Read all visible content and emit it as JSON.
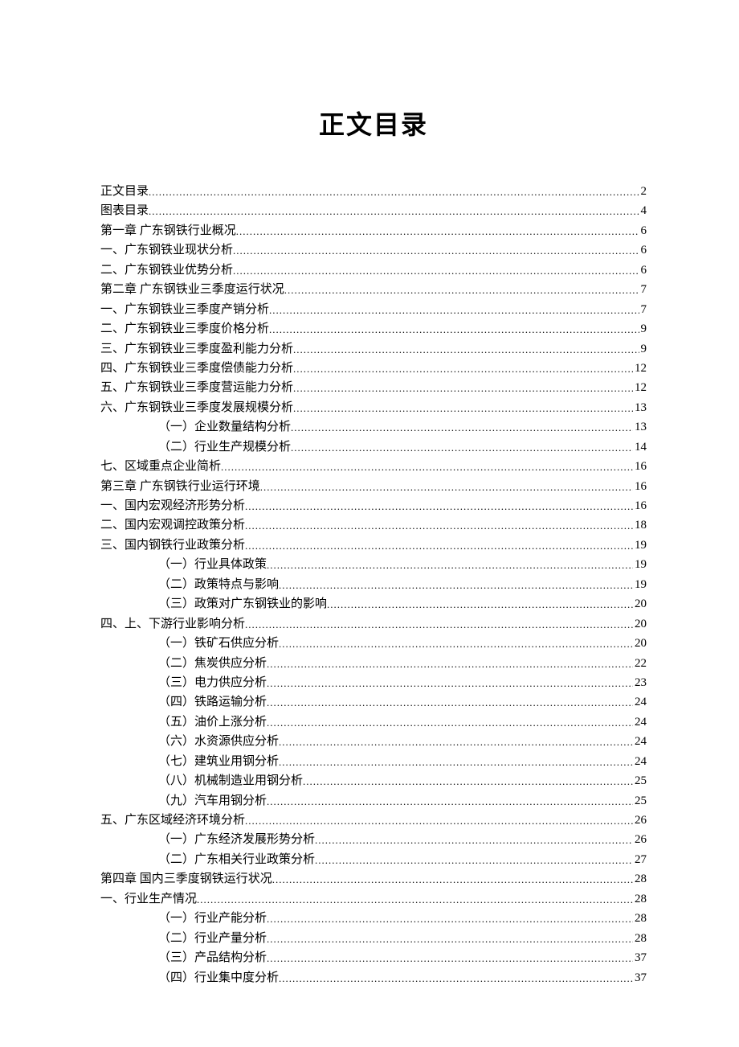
{
  "title": "正文目录",
  "toc": [
    {
      "label": "正文目录",
      "page": "2",
      "level": 0
    },
    {
      "label": "图表目录",
      "page": "4",
      "level": 0
    },
    {
      "label": "第一章 广东钢铁行业概况",
      "page": "6",
      "level": 0
    },
    {
      "label": "一、广东钢铁业现状分析",
      "page": "6",
      "level": 1
    },
    {
      "label": "二、广东钢铁业优势分析",
      "page": "6",
      "level": 1
    },
    {
      "label": "第二章 广东钢铁业三季度运行状况",
      "page": "7",
      "level": 0
    },
    {
      "label": "一、广东钢铁业三季度产销分析",
      "page": "7",
      "level": 1
    },
    {
      "label": "二、广东钢铁业三季度价格分析",
      "page": "9",
      "level": 1
    },
    {
      "label": "三、广东钢铁业三季度盈利能力分析",
      "page": "9",
      "level": 1
    },
    {
      "label": "四、广东钢铁业三季度偿债能力分析",
      "page": "12",
      "level": 1
    },
    {
      "label": "五、广东钢铁业三季度营运能力分析",
      "page": "12",
      "level": 1
    },
    {
      "label": "六、广东钢铁业三季度发展规模分析",
      "page": "13",
      "level": 1
    },
    {
      "label": "（一）企业数量结构分析",
      "page": "13",
      "level": 2
    },
    {
      "label": "（二）行业生产规模分析",
      "page": "14",
      "level": 2
    },
    {
      "label": "七、区域重点企业简析",
      "page": "16",
      "level": 1
    },
    {
      "label": "第三章 广东钢铁行业运行环境",
      "page": "16",
      "level": 0
    },
    {
      "label": "一、国内宏观经济形势分析",
      "page": "16",
      "level": 1
    },
    {
      "label": "二、国内宏观调控政策分析",
      "page": "18",
      "level": 1
    },
    {
      "label": "三、国内钢铁行业政策分析",
      "page": "19",
      "level": 1
    },
    {
      "label": "（一）行业具体政策",
      "page": "19",
      "level": 2
    },
    {
      "label": "（二）政策特点与影响",
      "page": "19",
      "level": 2
    },
    {
      "label": "（三）政策对广东钢铁业的影响",
      "page": "20",
      "level": 2
    },
    {
      "label": "四、上、下游行业影响分析",
      "page": "20",
      "level": 1
    },
    {
      "label": "（一）铁矿石供应分析",
      "page": "20",
      "level": 2
    },
    {
      "label": "（二）焦炭供应分析",
      "page": "22",
      "level": 2
    },
    {
      "label": "（三）电力供应分析",
      "page": "23",
      "level": 2
    },
    {
      "label": "（四）铁路运输分析",
      "page": "24",
      "level": 2
    },
    {
      "label": "（五）油价上涨分析",
      "page": "24",
      "level": 2
    },
    {
      "label": "（六）水资源供应分析",
      "page": "24",
      "level": 2
    },
    {
      "label": "（七）建筑业用钢分析",
      "page": "24",
      "level": 2
    },
    {
      "label": "（八）机械制造业用钢分析",
      "page": "25",
      "level": 2
    },
    {
      "label": "（九）汽车用钢分析",
      "page": "25",
      "level": 2
    },
    {
      "label": "五、广东区域经济环境分析",
      "page": "26",
      "level": 1
    },
    {
      "label": "（一）广东经济发展形势分析",
      "page": "26",
      "level": 2
    },
    {
      "label": "（二）广东相关行业政策分析",
      "page": "27",
      "level": 2
    },
    {
      "label": "第四章 国内三季度钢铁运行状况",
      "page": "28",
      "level": 0
    },
    {
      "label": "一、行业生产情况",
      "page": "28",
      "level": 1
    },
    {
      "label": "（一）行业产能分析",
      "page": "28",
      "level": 2
    },
    {
      "label": "（二）行业产量分析",
      "page": "28",
      "level": 2
    },
    {
      "label": "（三）产品结构分析",
      "page": "37",
      "level": 2
    },
    {
      "label": "（四）行业集中度分析",
      "page": "37",
      "level": 2
    }
  ]
}
